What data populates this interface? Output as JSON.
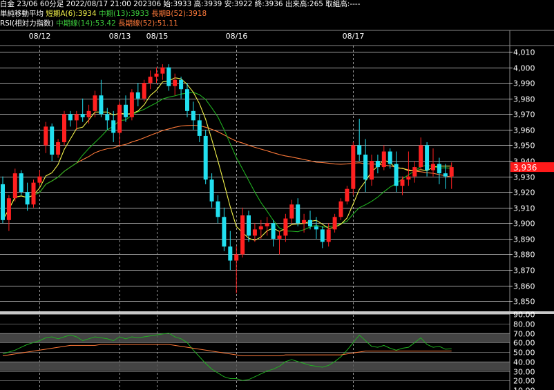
{
  "header": {
    "line1": "白金 23/06 60分足 2022/08/17 21:00 202306 始:3933 高:3939 安:3922 終:3936 出来高:265 取組高:----",
    "line2": {
      "label": "単純移動平均",
      "short": "短期A(6):3934",
      "mid": "中期(13):3933",
      "long": "長期B(52):3918"
    },
    "line3": {
      "label": "RSI(相対力指数)",
      "mid": "中期線(14):53.42",
      "long": "長期線(52):51.11"
    }
  },
  "colors": {
    "background": "#000000",
    "grid": "#ffffff",
    "candle_up": "#ff2020",
    "candle_down": "#22e0f0",
    "ma_short": "#f2f24a",
    "ma_mid": "#20b020",
    "ma_long": "#ff7a3a",
    "rsi_mid": "#20b020",
    "rsi_long": "#ff7a3a",
    "price_tag_bg": "#ff1a1a",
    "rsi_band": "#555555"
  },
  "chart_data": [
    {
      "type": "candlestick",
      "title": "白金 23/06 60分足",
      "date_labels": [
        "08/12",
        "08/13",
        "08/15",
        "08/16",
        "08/17"
      ],
      "price_ticks": [
        "4,010",
        "4,000",
        "3,990",
        "3,980",
        "3,970",
        "3,960",
        "3,950",
        "3,940",
        "3,930",
        "3,920",
        "3,910",
        "3,900",
        "3,890",
        "3,880",
        "3,870",
        "3,860",
        "3,850"
      ],
      "ylim": [
        3843,
        4014
      ],
      "current_price_label": "3,936",
      "current_price": 3936,
      "candles": [
        [
          3925,
          3930,
          3900,
          3902
        ],
        [
          3902,
          3918,
          3895,
          3916
        ],
        [
          3916,
          3935,
          3914,
          3932
        ],
        [
          3932,
          3934,
          3918,
          3920
        ],
        [
          3920,
          3926,
          3908,
          3912
        ],
        [
          3912,
          3928,
          3910,
          3926
        ],
        [
          3926,
          3934,
          3924,
          3930
        ],
        [
          3950,
          3965,
          3945,
          3962
        ],
        [
          3962,
          3964,
          3940,
          3944
        ],
        [
          3944,
          3954,
          3942,
          3952
        ],
        [
          3952,
          3972,
          3950,
          3970
        ],
        [
          3970,
          3972,
          3962,
          3966
        ],
        [
          3966,
          3972,
          3960,
          3970
        ],
        [
          3970,
          3980,
          3965,
          3968
        ],
        [
          3968,
          3976,
          3964,
          3972
        ],
        [
          3972,
          3985,
          3968,
          3982
        ],
        [
          3982,
          3992,
          3968,
          3970
        ],
        [
          3970,
          3974,
          3960,
          3966
        ],
        [
          3966,
          3972,
          3952,
          3958
        ],
        [
          3958,
          3978,
          3950,
          3976
        ],
        [
          3976,
          3982,
          3965,
          3968
        ],
        [
          3968,
          3986,
          3966,
          3984
        ],
        [
          3984,
          3990,
          3975,
          3980
        ],
        [
          3980,
          3992,
          3978,
          3990
        ],
        [
          3990,
          3998,
          3986,
          3994
        ],
        [
          3994,
          4000,
          3990,
          3996
        ],
        [
          3996,
          4002,
          3992,
          4000
        ],
        [
          4000,
          4002,
          3985,
          3988
        ],
        [
          3988,
          3996,
          3982,
          3992
        ],
        [
          3992,
          3994,
          3980,
          3986
        ],
        [
          3986,
          3990,
          3968,
          3972
        ],
        [
          3972,
          3978,
          3960,
          3966
        ],
        [
          3966,
          3970,
          3952,
          3956
        ],
        [
          3956,
          3960,
          3925,
          3928
        ],
        [
          3928,
          3932,
          3910,
          3914
        ],
        [
          3914,
          3918,
          3900,
          3904
        ],
        [
          3904,
          3910,
          3882,
          3885
        ],
        [
          3885,
          3895,
          3870,
          3876
        ],
        [
          3876,
          3885,
          3855,
          3880
        ],
        [
          3880,
          3910,
          3878,
          3905
        ],
        [
          3905,
          3908,
          3888,
          3892
        ],
        [
          3892,
          3900,
          3888,
          3896
        ],
        [
          3896,
          3902,
          3890,
          3898
        ],
        [
          3898,
          3904,
          3892,
          3900
        ],
        [
          3900,
          3902,
          3885,
          3890
        ],
        [
          3890,
          3895,
          3880,
          3892
        ],
        [
          3892,
          3906,
          3888,
          3903
        ],
        [
          3903,
          3915,
          3900,
          3912
        ],
        [
          3912,
          3916,
          3898,
          3900
        ],
        [
          3900,
          3906,
          3894,
          3902
        ],
        [
          3902,
          3908,
          3896,
          3898
        ],
        [
          3898,
          3904,
          3890,
          3896
        ],
        [
          3896,
          3898,
          3884,
          3888
        ],
        [
          3888,
          3900,
          3885,
          3896
        ],
        [
          3896,
          3906,
          3894,
          3904
        ],
        [
          3904,
          3916,
          3902,
          3914
        ],
        [
          3914,
          3924,
          3912,
          3922
        ],
        [
          3922,
          3952,
          3918,
          3950
        ],
        [
          3950,
          3967,
          3940,
          3944
        ],
        [
          3944,
          3954,
          3920,
          3928
        ],
        [
          3928,
          3944,
          3924,
          3940
        ],
        [
          3940,
          3944,
          3932,
          3936
        ],
        [
          3936,
          3950,
          3934,
          3946
        ],
        [
          3946,
          3948,
          3935,
          3938
        ],
        [
          3938,
          3946,
          3920,
          3924
        ],
        [
          3924,
          3930,
          3918,
          3928
        ],
        [
          3928,
          3946,
          3924,
          3930
        ],
        [
          3930,
          3940,
          3926,
          3936
        ],
        [
          3936,
          3955,
          3934,
          3950
        ],
        [
          3950,
          3952,
          3930,
          3934
        ],
        [
          3934,
          3948,
          3930,
          3938
        ],
        [
          3938,
          3942,
          3925,
          3932
        ],
        [
          3932,
          3938,
          3922,
          3930
        ],
        [
          3930,
          3939,
          3922,
          3936
        ]
      ],
      "series": [
        {
          "name": "短期A(6)",
          "last": 3934
        },
        {
          "name": "中期(13)",
          "last": 3933
        },
        {
          "name": "長期B(52)",
          "last": 3918
        }
      ]
    },
    {
      "type": "line",
      "title": "RSI(相対力指数)",
      "ticks": [
        "90.00",
        "80.00",
        "70.00",
        "60.00",
        "50.00",
        "40.00",
        "30.00",
        "20.00",
        "10.00"
      ],
      "ylim": [
        10,
        90
      ],
      "bands": [
        [
          30,
          40
        ],
        [
          60,
          70
        ]
      ],
      "series": [
        {
          "name": "中期線(14)",
          "last": 53.42,
          "values": [
            48,
            50,
            52,
            55,
            58,
            60,
            62,
            65,
            66,
            64,
            66,
            68,
            66,
            62,
            64,
            66,
            65,
            64,
            62,
            66,
            64,
            66,
            65,
            66,
            67,
            68,
            69,
            70,
            66,
            64,
            60,
            52,
            45,
            38,
            32,
            28,
            24,
            22,
            22,
            20,
            21,
            24,
            27,
            30,
            32,
            35,
            40,
            42,
            40,
            38,
            36,
            35,
            34,
            36,
            40,
            45,
            52,
            60,
            68,
            62,
            56,
            55,
            57,
            54,
            52,
            54,
            55,
            60,
            65,
            58,
            55,
            56,
            53,
            53.42
          ]
        },
        {
          "name": "長期線(52)",
          "last": 51.11,
          "values": [
            46,
            47,
            48,
            49,
            50,
            51,
            52,
            53,
            54,
            55,
            56,
            57,
            57,
            57,
            57,
            57,
            58,
            58,
            58,
            58,
            58,
            58,
            58,
            58,
            58,
            58,
            58,
            58,
            57,
            56,
            55,
            54,
            53,
            52,
            51,
            50,
            49,
            48,
            47,
            46,
            46,
            46,
            46,
            46,
            46,
            46,
            47,
            47,
            47,
            47,
            47,
            47,
            47,
            47,
            47,
            47,
            48,
            49,
            50,
            51,
            51,
            51,
            51,
            51,
            51,
            51,
            51,
            51,
            51,
            51,
            51,
            51,
            51,
            51.11
          ]
        }
      ]
    }
  ]
}
